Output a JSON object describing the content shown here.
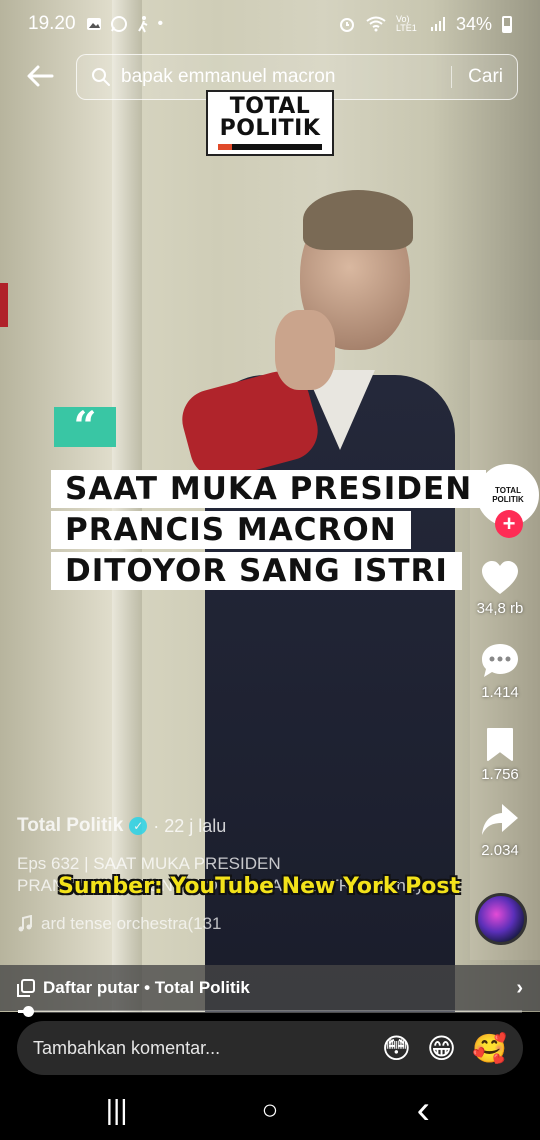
{
  "status_bar": {
    "time": "19.20",
    "notification_icons": [
      "image-icon",
      "whatsapp-icon",
      "walk-icon"
    ],
    "dot": "•",
    "network": "Vo) LTE1",
    "battery": "34%"
  },
  "search": {
    "query": "bapak emmanuel macron",
    "submit_label": "Cari"
  },
  "logo": {
    "line1": "TOTAL",
    "line2": "POLITIK"
  },
  "video": {
    "quote_mark": "“",
    "headline": [
      "SAAT MUKA PRESIDEN",
      "PRANCIS MACRON",
      "DITOYOR SANG ISTRI"
    ]
  },
  "rail": {
    "avatar_text1": "TOTAL",
    "avatar_text2": "POLITIK",
    "follow": "+",
    "likes": "34,8 rb",
    "comments": "1.414",
    "saves": "1.756",
    "shares": "2.034"
  },
  "caption": {
    "creator": "Total Politik",
    "time_ago": "· 22 j lalu",
    "text_line1": "Eps 632 | SAAT MUKA PRESIDEN",
    "text_line2": "PRANCIS MACRON DITOYOR SANG ISTRI ... lainnya",
    "source": "Sumber: YouTube New York Post",
    "music": "ard tense orchestra(131"
  },
  "playlist": {
    "label": "Daftar putar • Total Politik"
  },
  "progress": {
    "value": 0.02
  },
  "comment": {
    "placeholder": "Tambahkan komentar...",
    "emojis": [
      "😳",
      "😁",
      "🥰"
    ]
  },
  "navbar": {
    "recent": "|||",
    "home": "○",
    "back": "‹"
  }
}
